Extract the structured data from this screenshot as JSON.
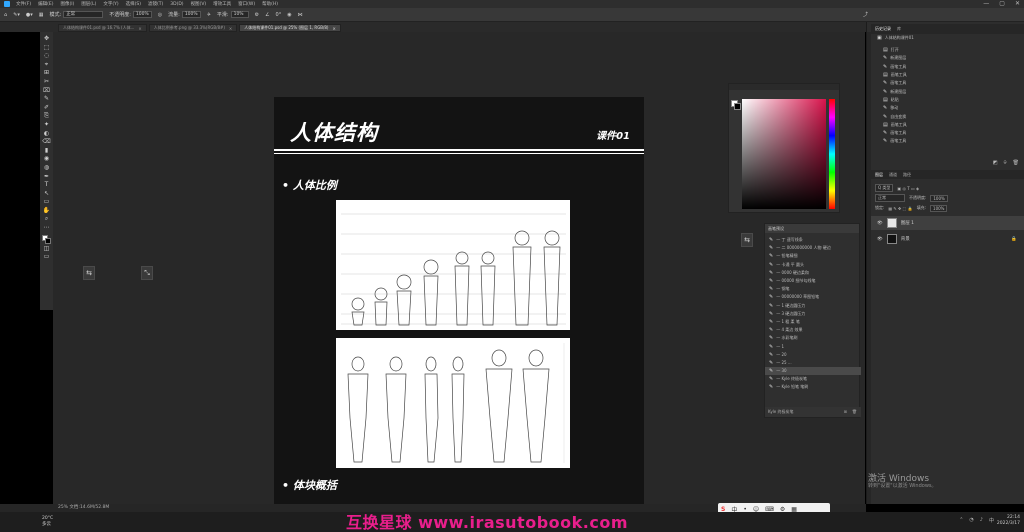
{
  "menubar": {
    "items": [
      "文件(F)",
      "编辑(E)",
      "图像(I)",
      "图层(L)",
      "文字(Y)",
      "选择(S)",
      "滤镜(T)",
      "3D(D)",
      "视图(V)",
      "增效工具",
      "窗口(W)",
      "帮助(H)"
    ],
    "window_controls": [
      "—",
      "▢",
      "✕"
    ]
  },
  "options_bar": {
    "mode_label": "模式:",
    "mode_value": "正常",
    "opacity_label": "不透明度:",
    "opacity_value": "100%",
    "flow_label": "流量:",
    "flow_value": "100%",
    "smoothing_label": "平滑:",
    "smoothing_value": "10%",
    "angle_value": "0°"
  },
  "tabs": [
    {
      "label": "人体结构课件01.psd @ 16.7% (人体...",
      "active": false
    },
    {
      "label": "人体比例参考.png @ 33.3%(RGB/8#)",
      "active": false
    },
    {
      "label": "人体结构课件01.psd @ 25% (图层 1, RGB/8)",
      "active": true
    }
  ],
  "tools": [
    "✥",
    "⬚",
    "◌",
    "⌖",
    "⊞",
    "✂",
    "⌧",
    "✎",
    "✐",
    "⎘",
    "✦",
    "◐",
    "⌫",
    "▮",
    "◉",
    "◍",
    "✒",
    "T",
    "↖",
    "▭",
    "✋",
    "⌕",
    "⋯"
  ],
  "document": {
    "title": "人体结构",
    "lesson": "课件01",
    "section1": "• 人体比例",
    "section2": "• 体块概括"
  },
  "color_panel": {
    "foreground": "#ffffff",
    "background": "#000000",
    "hue_color": "#d8134b"
  },
  "brush_panel": {
    "title": "画笔预设",
    "items": [
      "一 丁 速写线条",
      "一 二 0000000000 人物 硬边",
      "一 铅笔精细",
      "一 卡通 平 圆头",
      "一 0000 硬边柔和",
      "一 00000 细节勾线笔",
      "一 钢笔",
      "一 00000000 草图铅笔",
      "一 1 硬边圆压力",
      "一 3 硬边圆压力",
      "一 1 粗 柔 笔",
      "一 4 柔边 效果",
      "一 水彩笔刷",
      "一 1",
      "一 20",
      "一 25 ... ",
      "一 30",
      "一 Kyle 终极炭笔",
      "一 Kyle 铅笔 笔刷"
    ],
    "selected_index": 16,
    "footer": "Kyle 终极炭笔"
  },
  "history_panel": {
    "tabs": [
      "历史记录",
      "库"
    ],
    "snapshot": "人体结构课件01",
    "items": [
      "打开",
      "新建图层",
      "画笔工具",
      "画笔工具",
      "画笔工具",
      "新建图层",
      "粘贴",
      "移动",
      "自由变换",
      "画笔工具",
      "画笔工具",
      "画笔工具"
    ]
  },
  "layers_panel": {
    "tabs": [
      "图层",
      "通道",
      "路径"
    ],
    "filter_label": "Q 类型",
    "blend_mode": "正常",
    "opacity_label": "不透明度:",
    "opacity_value": "100%",
    "lock_label": "锁定:",
    "fill_label": "填充:",
    "fill_value": "100%",
    "layers": [
      {
        "name": "图层 1",
        "selected": true
      },
      {
        "name": "背景",
        "selected": false
      }
    ]
  },
  "activation": {
    "line1": "激活 Windows",
    "line2": "转到\"设置\"以激活 Windows。"
  },
  "status": "25% 文档:14.6M/52.8M",
  "taskbar": {
    "weather_temp": "20°C",
    "weather_desc": "多云",
    "time": "22:14",
    "date": "2022/3/17",
    "brand": "互换星球 www.irasutobook.com"
  },
  "ime": {
    "logo": "S",
    "icons": [
      "中",
      "•",
      "☺",
      "⌨",
      "⚙",
      "▦"
    ]
  }
}
